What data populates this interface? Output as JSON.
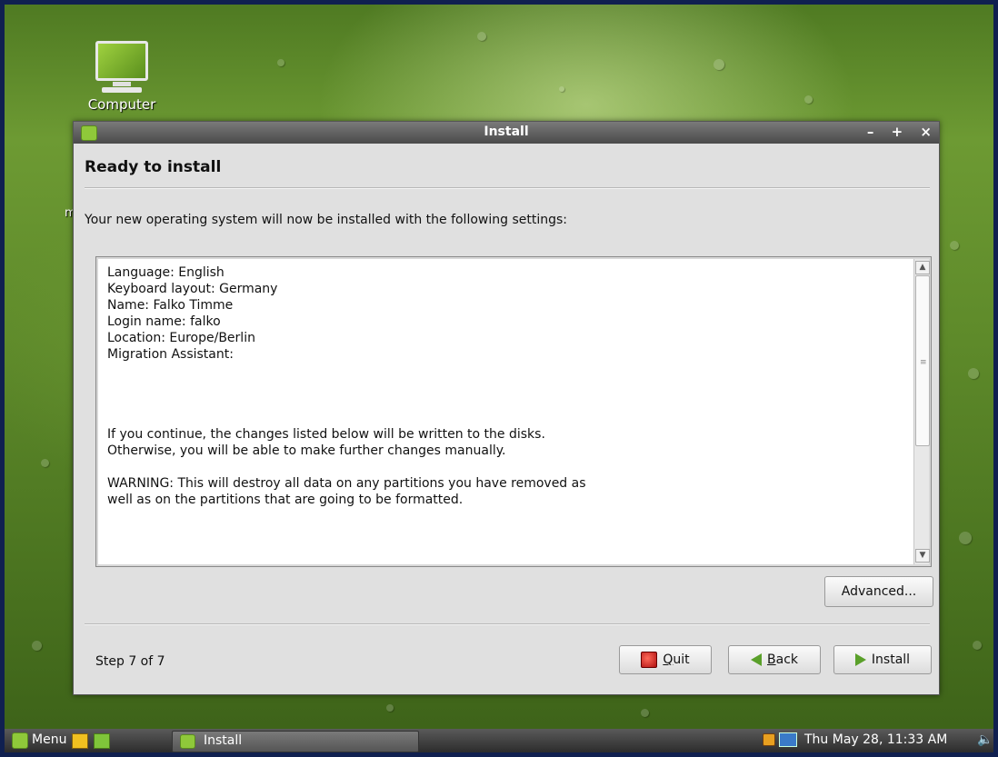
{
  "desktop": {
    "icons": [
      {
        "label": "Computer",
        "icon": "computer-icon"
      }
    ],
    "stray_char": "m"
  },
  "window": {
    "title": "Install",
    "controls": {
      "minimize": "–",
      "maximize": "+",
      "close": "×"
    },
    "heading": "Ready to install",
    "intro": "Your new operating system will now be installed with the following settings:",
    "summary": {
      "settings": [
        "Language: English",
        "Keyboard layout: Germany",
        "Name: Falko Timme",
        "Login name: falko",
        "Location: Europe/Berlin",
        "Migration Assistant:"
      ],
      "continue_note": [
        "If you continue, the changes listed below will be written to the disks.",
        "Otherwise, you will be able to make further changes manually."
      ],
      "warning": [
        "WARNING: This will destroy all data on any partitions you have removed as",
        "well as on the partitions that are going to be formatted."
      ]
    },
    "advanced_label": "Advanced...",
    "step_text": "Step 7 of 7",
    "buttons": {
      "quit": {
        "accel": "Q",
        "rest": "uit",
        "icon": "quit-icon"
      },
      "back": {
        "accel": "B",
        "rest": "ack",
        "icon": "back-arrow-icon"
      },
      "install": {
        "label": "Install",
        "icon": "forward-arrow-icon"
      }
    }
  },
  "taskbar": {
    "menu_label": "Menu",
    "task_label": "Install",
    "clock": "Thu May 28, 11:33 AM"
  }
}
